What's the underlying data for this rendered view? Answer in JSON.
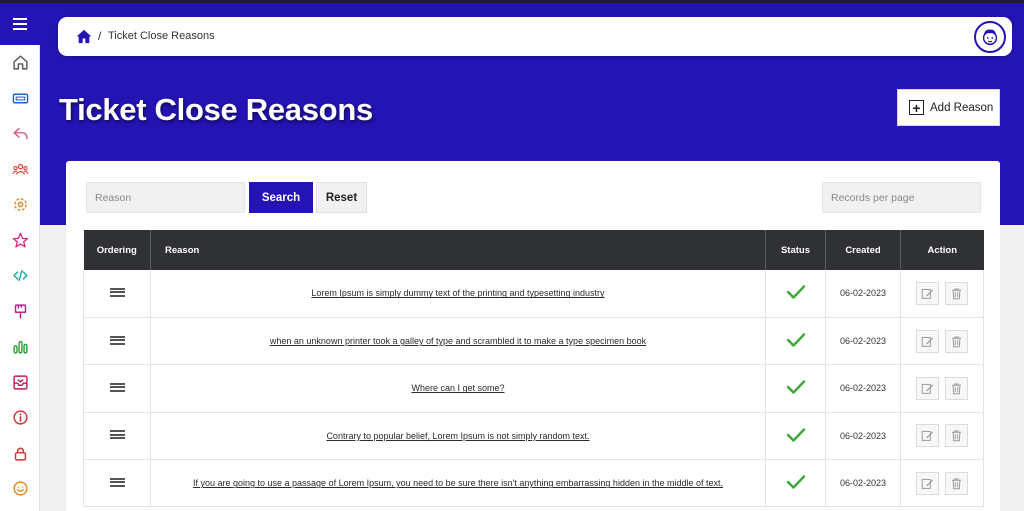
{
  "breadcrumb": {
    "home_icon": "home-icon",
    "separator": "/",
    "current": "Ticket Close Reasons"
  },
  "page": {
    "title": "Ticket Close Reasons",
    "add_button_label": "Add Reason"
  },
  "sidebar": {
    "menu_icon": "hamburger-icon",
    "items": [
      {
        "icon": "home-icon",
        "color": "#555555"
      },
      {
        "icon": "ticket-icon",
        "color": "#1e63d6"
      },
      {
        "icon": "reply-icon",
        "color": "#e05a86"
      },
      {
        "icon": "users-icon",
        "color": "#e0463b"
      },
      {
        "icon": "gear-icon",
        "color": "#e08a1e"
      },
      {
        "icon": "star-icon",
        "color": "#d9247a"
      },
      {
        "icon": "code-icon",
        "color": "#1aa9a3"
      },
      {
        "icon": "brush-icon",
        "color": "#c21b8c"
      },
      {
        "icon": "bar-chart-icon",
        "color": "#2a9d36"
      },
      {
        "icon": "inbox-icon",
        "color": "#c2185b"
      },
      {
        "icon": "info-icon",
        "color": "#d32f2f"
      },
      {
        "icon": "lock-icon",
        "color": "#d32f2f"
      },
      {
        "icon": "smile-icon",
        "color": "#e08a1e"
      }
    ]
  },
  "filters": {
    "reason_placeholder": "Reason",
    "search_label": "Search",
    "reset_label": "Reset",
    "records_placeholder": "Records per page"
  },
  "table": {
    "headers": {
      "ordering": "Ordering",
      "reason": "Reason",
      "status": "Status",
      "created": "Created",
      "action": "Action"
    },
    "rows": [
      {
        "reason": "Lorem Ipsum is simply dummy text of the printing and typesetting industry",
        "status": "active",
        "created": "06-02-2023"
      },
      {
        "reason": "when an unknown printer took a galley of type and scrambled it to make a type specimen book",
        "status": "active",
        "created": "06-02-2023"
      },
      {
        "reason": "Where can I get some?",
        "status": "active",
        "created": "06-02-2023"
      },
      {
        "reason": "Contrary to popular belief, Lorem Ipsum is not simply random text.",
        "status": "active",
        "created": "06-02-2023"
      },
      {
        "reason": "If you are going to use a passage of Lorem Ipsum, you need to be sure there isn't anything embarrassing hidden in the middle of text.",
        "status": "active",
        "created": "06-02-2023"
      }
    ]
  },
  "colors": {
    "primary": "#2314b3",
    "header_dark": "#2f3134",
    "check_green": "#3aa935"
  }
}
